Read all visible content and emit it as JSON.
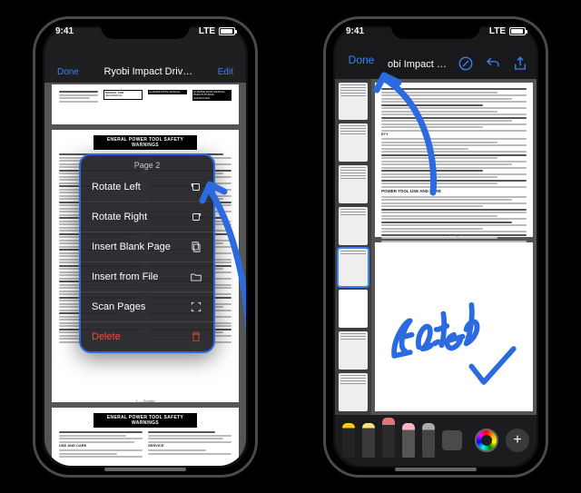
{
  "status": {
    "time": "9:41",
    "carrier": "LTE"
  },
  "left": {
    "topbar": {
      "back": "Done",
      "title": "Ryobi Impact Driv…",
      "edit": "Edit"
    },
    "page_header": "ENERAL POWER TOOL SAFETY WARNINGS",
    "menu": {
      "page_label": "Page 2",
      "items": [
        {
          "label": "Rotate Left",
          "icon": "rotate-left-icon"
        },
        {
          "label": "Rotate Right",
          "icon": "rotate-right-icon"
        },
        {
          "label": "Insert Blank Page",
          "icon": "insert-blank-icon"
        },
        {
          "label": "Insert from File",
          "icon": "insert-file-icon"
        },
        {
          "label": "Scan Pages",
          "icon": "scan-icon"
        },
        {
          "label": "Delete",
          "icon": "trash-icon"
        }
      ]
    }
  },
  "right": {
    "nav": {
      "done": "Done",
      "title": "obi Impact Driv…"
    },
    "page_header": "POWER TOOL USE AND CARE",
    "annotation_text": "Edited",
    "accent": "#2b6adf",
    "tools": [
      "pen",
      "marker",
      "pencil",
      "eraser",
      "lasso",
      "ruler"
    ]
  }
}
